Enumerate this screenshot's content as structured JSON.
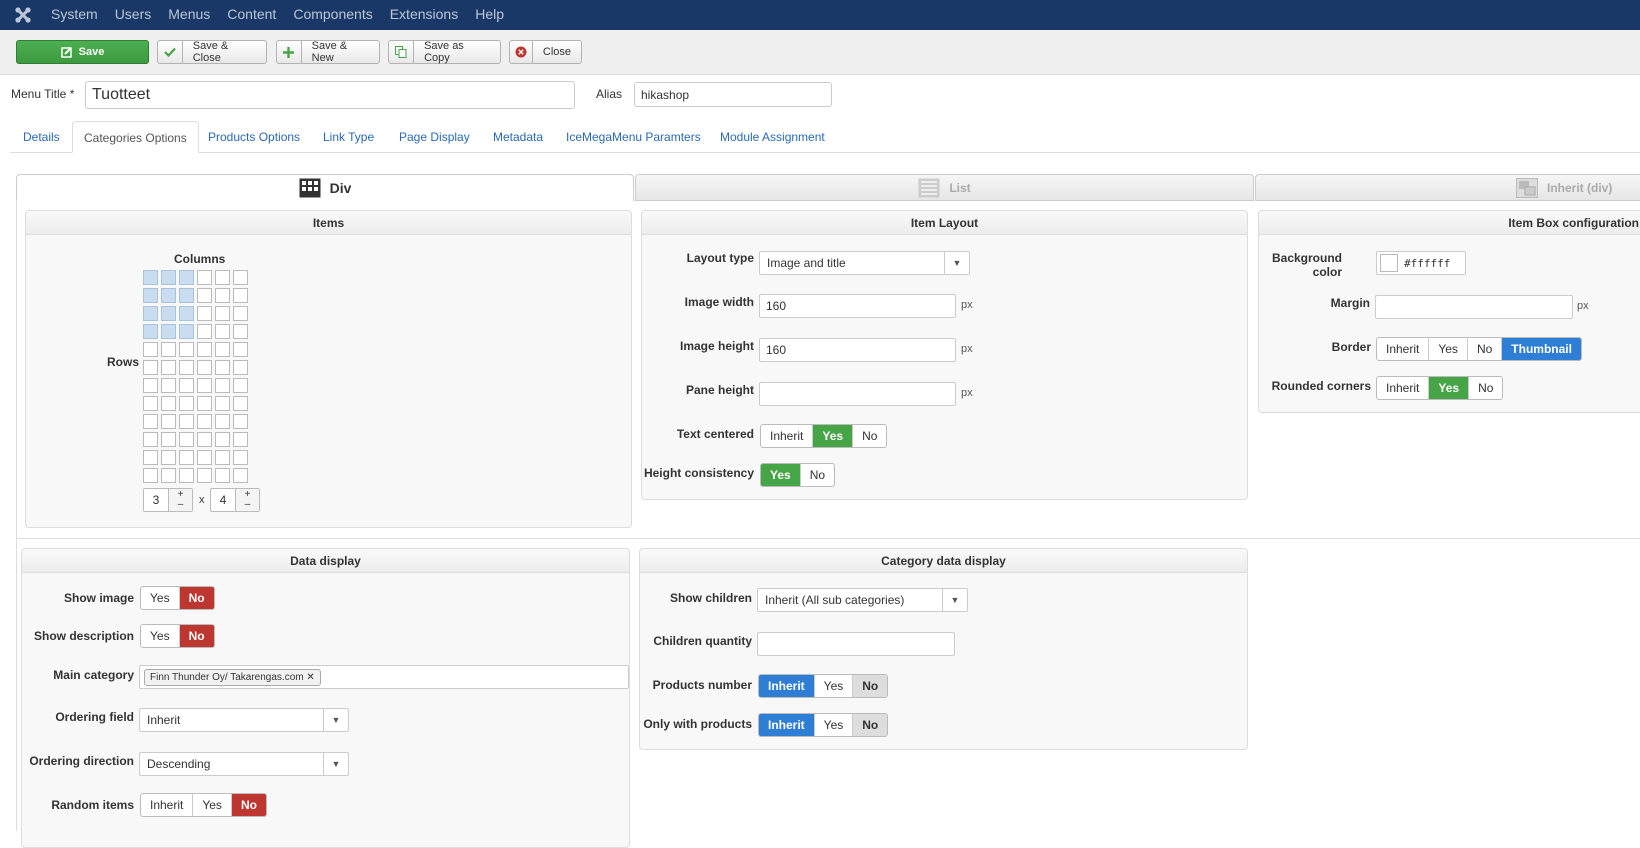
{
  "nav": {
    "items": [
      "System",
      "Users",
      "Menus",
      "Content",
      "Components",
      "Extensions",
      "Help"
    ]
  },
  "toolbar": {
    "save": "Save",
    "save_close": "Save & Close",
    "save_new": "Save & New",
    "save_copy": "Save as Copy",
    "close": "Close"
  },
  "header": {
    "menu_title_label": "Menu Title *",
    "menu_title_value": "Tuotteet",
    "alias_label": "Alias",
    "alias_value": "hikashop"
  },
  "tabs": [
    "Details",
    "Categories Options",
    "Products Options",
    "Link Type",
    "Page Display",
    "Metadata",
    "IceMegaMenu Paramters",
    "Module Assignment"
  ],
  "layout_tabs": {
    "div": "Div",
    "list": "List",
    "inherit": "Inherit (div)"
  },
  "items_panel": {
    "title": "Items",
    "columns_label": "Columns",
    "rows_label": "Rows",
    "selected_columns": 3,
    "selected_rows": 4,
    "grid_columns": 6,
    "grid_rows": 12,
    "columns_value": "3",
    "x_label": "x",
    "rows_value": "4"
  },
  "item_layout": {
    "title": "Item Layout",
    "layout_type_label": "Layout type",
    "layout_type_value": "Image and title",
    "image_width_label": "Image width",
    "image_width_value": "160",
    "image_height_label": "Image height",
    "image_height_value": "160",
    "pane_height_label": "Pane height",
    "pane_height_value": "",
    "unit": "px",
    "text_centered_label": "Text centered",
    "text_centered_options": [
      "Inherit",
      "Yes",
      "No"
    ],
    "height_consistency_label": "Height consistency",
    "height_consistency_options": [
      "Yes",
      "No"
    ]
  },
  "item_box": {
    "title": "Item Box configuration",
    "bg_color_label": "Background color",
    "bg_color_value": "#ffffff",
    "margin_label": "Margin",
    "margin_value": "",
    "unit": "px",
    "border_label": "Border",
    "border_options": [
      "Inherit",
      "Yes",
      "No",
      "Thumbnail"
    ],
    "rounded_label": "Rounded corners",
    "rounded_options": [
      "Inherit",
      "Yes",
      "No"
    ]
  },
  "data_display": {
    "title": "Data display",
    "show_image_label": "Show image",
    "show_image_options": [
      "Yes",
      "No"
    ],
    "show_desc_label": "Show description",
    "show_desc_options": [
      "Yes",
      "No"
    ],
    "main_category_label": "Main category",
    "main_category_tag": "Finn Thunder Oy/ Takarengas.com",
    "ordering_field_label": "Ordering field",
    "ordering_field_value": "Inherit",
    "ordering_dir_label": "Ordering direction",
    "ordering_dir_value": "Descending",
    "random_items_label": "Random items",
    "random_items_options": [
      "Inherit",
      "Yes",
      "No"
    ]
  },
  "category_display": {
    "title": "Category data display",
    "show_children_label": "Show children",
    "show_children_value": "Inherit (All sub categories)",
    "children_qty_label": "Children quantity",
    "children_qty_value": "",
    "products_number_label": "Products number",
    "products_number_options": [
      "Inherit",
      "Yes",
      "No"
    ],
    "only_products_label": "Only with products",
    "only_products_options": [
      "Inherit",
      "Yes",
      "No"
    ]
  },
  "colors": {
    "nav_bg": "#1a3867",
    "green": "#46a546",
    "red": "#bd362f",
    "blue": "#2f7ed6",
    "link": "#2a69b8"
  }
}
